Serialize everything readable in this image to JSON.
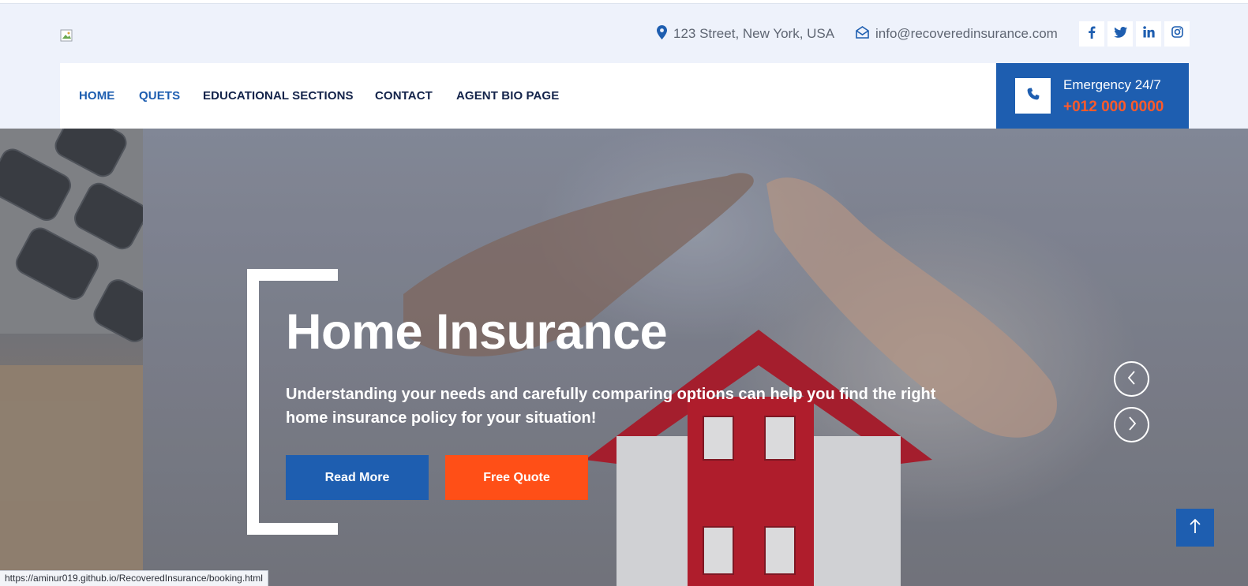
{
  "topbar": {
    "logo_icon": "broken-image-icon",
    "address": "123 Street, New York, USA",
    "address_icon": "map-pin-icon",
    "email": "info@recoveredinsurance.com",
    "email_icon": "envelope-open-icon",
    "social": [
      "facebook-icon",
      "twitter-icon",
      "linkedin-icon",
      "instagram-icon"
    ]
  },
  "nav": {
    "items": [
      {
        "label": "HOME",
        "active": true
      },
      {
        "label": "QUETS",
        "active": true
      },
      {
        "label": "EDUCATIONAL SECTIONS",
        "active": false
      },
      {
        "label": "CONTACT",
        "active": false
      },
      {
        "label": "AGENT BIO PAGE",
        "active": false
      }
    ]
  },
  "emergency": {
    "icon": "phone-icon",
    "title": "Emergency 24/7",
    "phone": "+012 000 0000"
  },
  "hero": {
    "title": "Home Insurance",
    "text": "Understanding your needs and carefully comparing options can help you find the right home insurance policy for your situation!",
    "read_more": "Read More",
    "free_quote": "Free Quote",
    "prev_icon": "chevron-left-icon",
    "next_icon": "chevron-right-icon"
  },
  "back_to_top_icon": "arrow-up-icon",
  "status_url": "https://aminur019.github.io/RecoveredInsurance/booking.html",
  "colors": {
    "primary": "#1e5eb0",
    "accent": "#ff4f17",
    "phone_accent": "#ff5a2a",
    "nav_text": "#13234a",
    "topbar_bg": "#eef2fb"
  }
}
